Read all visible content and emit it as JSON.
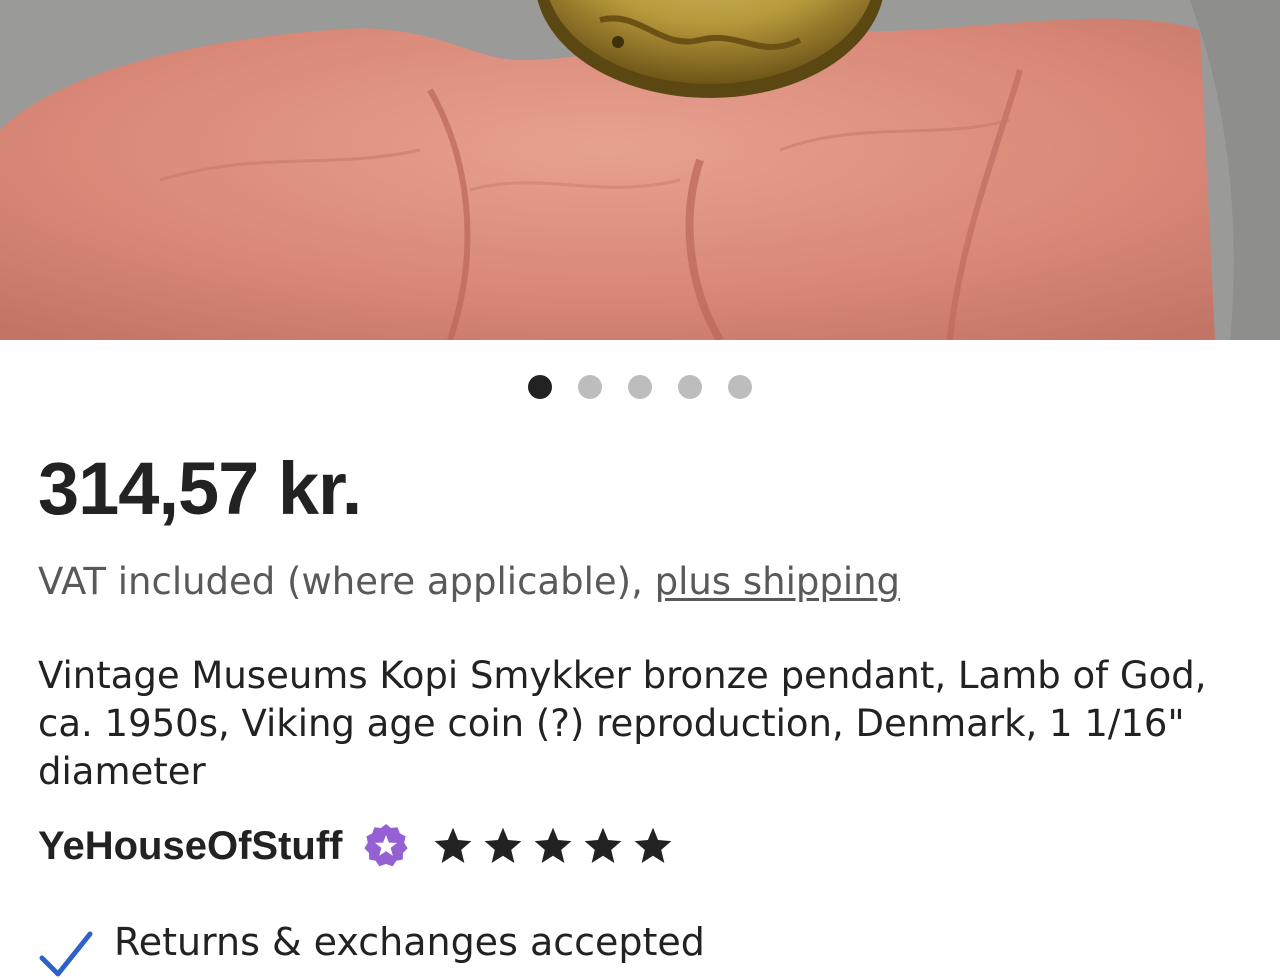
{
  "carousel": {
    "image_icon": "product-photo-hand-holding-bronze-pendant",
    "dots": [
      {
        "active": true
      },
      {
        "active": false
      },
      {
        "active": false
      },
      {
        "active": false
      },
      {
        "active": false
      }
    ]
  },
  "listing": {
    "price": "314,57 kr.",
    "vat_text": "VAT included (where applicable), ",
    "shipping_link": "plus shipping",
    "title": "Vintage Museums Kopi Smykker bronze pendant, Lamb of God, ca. 1950s, Viking age coin (?) reproduction, Denmark, 1 1/16\" diameter"
  },
  "shop": {
    "name": "YeHouseOfStuff",
    "badge_icon": "star-seller-badge-icon",
    "badge_color": "#9560d4",
    "rating": 5,
    "rating_max": 5
  },
  "features": {
    "returns_label": "Returns & exchanges accepted",
    "check_color": "#2f62c8"
  }
}
